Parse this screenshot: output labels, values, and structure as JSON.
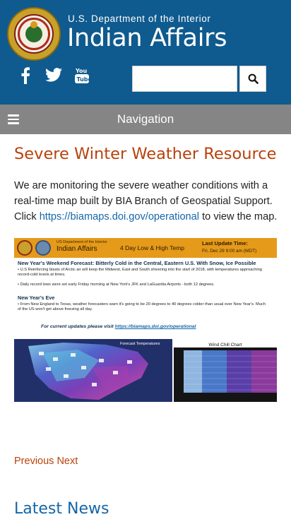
{
  "header": {
    "agency_line": "U.S. Department of the Interior",
    "site_title": "Indian Affairs",
    "logo_icon": "department-seal",
    "social": [
      {
        "name": "facebook-icon"
      },
      {
        "name": "twitter-icon"
      },
      {
        "name": "youtube-icon"
      }
    ],
    "search": {
      "value": "",
      "placeholder": "",
      "button_icon": "search-icon"
    },
    "colors": {
      "header_bg": "#0f5a8e",
      "nav_bg": "#858585"
    }
  },
  "nav": {
    "label": "Navigation",
    "icon": "hamburger-icon"
  },
  "main": {
    "heading": "Severe Winter Weather Resource",
    "intro_before": "We are monitoring the severe weather conditions with a real-time map built by BIA Branch of Geospatial Support. Click ",
    "intro_link": "https://biamaps.doi.gov/operational",
    "intro_after": " to view the map.",
    "infographic": {
      "agency_small": "US Department of the Interior",
      "agency": "Indian Affairs",
      "temp_title": "4 Day Low & High Temp",
      "update_label": "Last Update Time:",
      "update_time": "Fri, Dec 29 9:00 am (MDT)",
      "headline": "New Year's Weekend Forecast: Bitterly Cold in the Central, Eastern U.S. With Snow, Ice Possible",
      "bullet1": "• U.S Reinforcing blasts of Arctic air will keep the Midwest, East and South shivering into the start of 2018, with temperatures approaching record-cold levels at times.",
      "bullet2": "• Daily record lows were set early Friday morning at New York's JFK and LaGuardia Airports - both 12 degrees.",
      "subhead": "New Year's Eve",
      "bullet3": "• From New England to Texas, weather forecasters warn it's going to be 20 degrees to 40 degrees colder than usual over New Year's. Much of the US won't get above freezing all day.",
      "updates_prefix": "For current updates please visit ",
      "updates_link": "https://biamaps.doi.gov/operational",
      "map_label": "Forecast Temperatures",
      "windchill_title": "Wind Chill Chart"
    }
  },
  "pager": {
    "previous": "Previous",
    "next": "Next"
  },
  "latest_news": {
    "heading": "Latest News"
  },
  "accent_colors": {
    "heading_orange": "#b8420c",
    "link_blue": "#1466a8",
    "news_blue": "#1566a6"
  }
}
